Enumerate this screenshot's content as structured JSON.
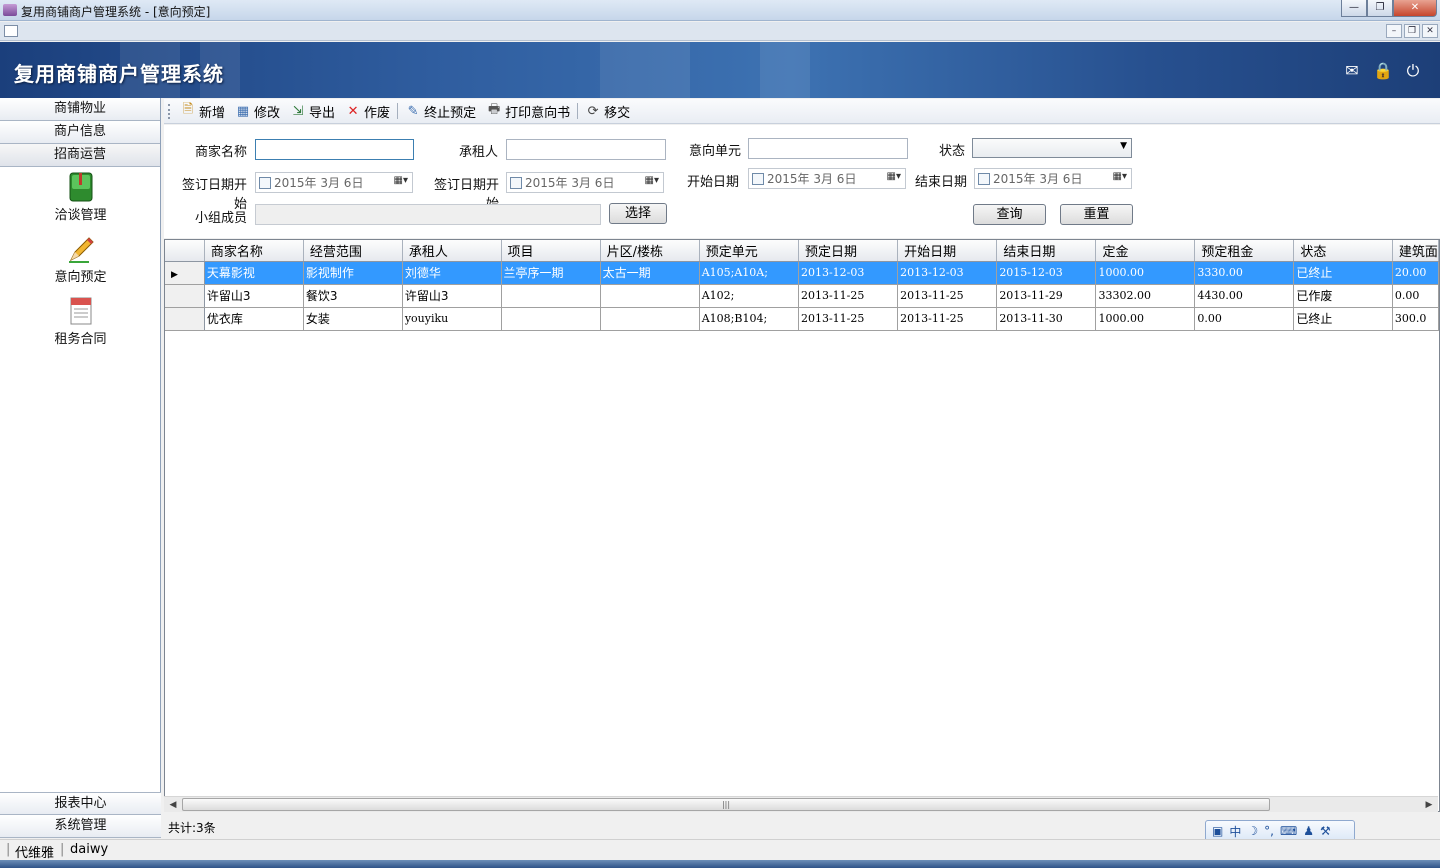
{
  "window": {
    "title": "复用商铺商户管理系统 - [意向预定]"
  },
  "banner": {
    "system_title": "复用商铺商户管理系统",
    "icons": [
      "message-icon",
      "lock-icon",
      "power-icon"
    ]
  },
  "nav": {
    "top": [
      "商铺物业",
      "商户信息",
      "招商运营"
    ],
    "items": [
      {
        "label": "洽谈管理",
        "icon": "book-icon"
      },
      {
        "label": "意向预定",
        "icon": "pencil-icon"
      },
      {
        "label": "租务合同",
        "icon": "document-icon"
      }
    ],
    "bottom": [
      "报表中心",
      "系统管理"
    ]
  },
  "toolbar": {
    "add": "新增",
    "edit": "修改",
    "export": "导出",
    "void": "作废",
    "terminate": "终止预定",
    "print": "打印意向书",
    "transfer": "移交"
  },
  "filters": {
    "merchant_label": "商家名称",
    "merchant_value": "",
    "tenant_label": "承租人",
    "tenant_value": "",
    "unit_label": "意向单元",
    "unit_value": "",
    "status_label": "状态",
    "status_value": "",
    "sign_start_label": "签订日期开始",
    "sign_start_value": "2015年  3月  6日",
    "sign_end_label": "签订日期开始",
    "sign_end_value": "2015年  3月  6日",
    "start_label": "开始日期",
    "start_value": "2015年  3月  6日",
    "end_label": "结束日期",
    "end_value": "2015年  3月  6日",
    "team_label": "小组成员",
    "team_value": "",
    "choose_button": "选择",
    "query_button": "查询",
    "reset_button": "重置"
  },
  "grid": {
    "columns": [
      "商家名称",
      "经营范围",
      "承租人",
      "项目",
      "片区/楼栋",
      "预定单元",
      "预定日期",
      "开始日期",
      "结束日期",
      "定金",
      "预定租金",
      "状态",
      "建筑面"
    ],
    "rows": [
      [
        "天幕影视",
        "影视制作",
        "刘德华",
        "兰亭序一期",
        "太古一期",
        "A105;A10A;",
        "2013-12-03",
        "2013-12-03",
        "2015-12-03",
        "1000.00",
        "3330.00",
        "已终止",
        "20.00"
      ],
      [
        "许留山3",
        "餐饮3",
        "许留山3",
        "",
        "",
        "A102;",
        "2013-11-25",
        "2013-11-25",
        "2013-11-29",
        "33302.00",
        "4430.00",
        "已作废",
        "0.00"
      ],
      [
        "优衣库",
        "女装",
        "youyiku",
        "",
        "",
        "A108;B104;",
        "2013-11-25",
        "2013-11-25",
        "2013-11-30",
        "1000.00",
        "0.00",
        "已终止",
        "300.0"
      ]
    ],
    "selected_row": 0
  },
  "footer": {
    "count": "共计:3条"
  },
  "ime": {
    "mode": "中"
  },
  "status": {
    "user_name": "代维雅",
    "user_id": "daiwy"
  }
}
